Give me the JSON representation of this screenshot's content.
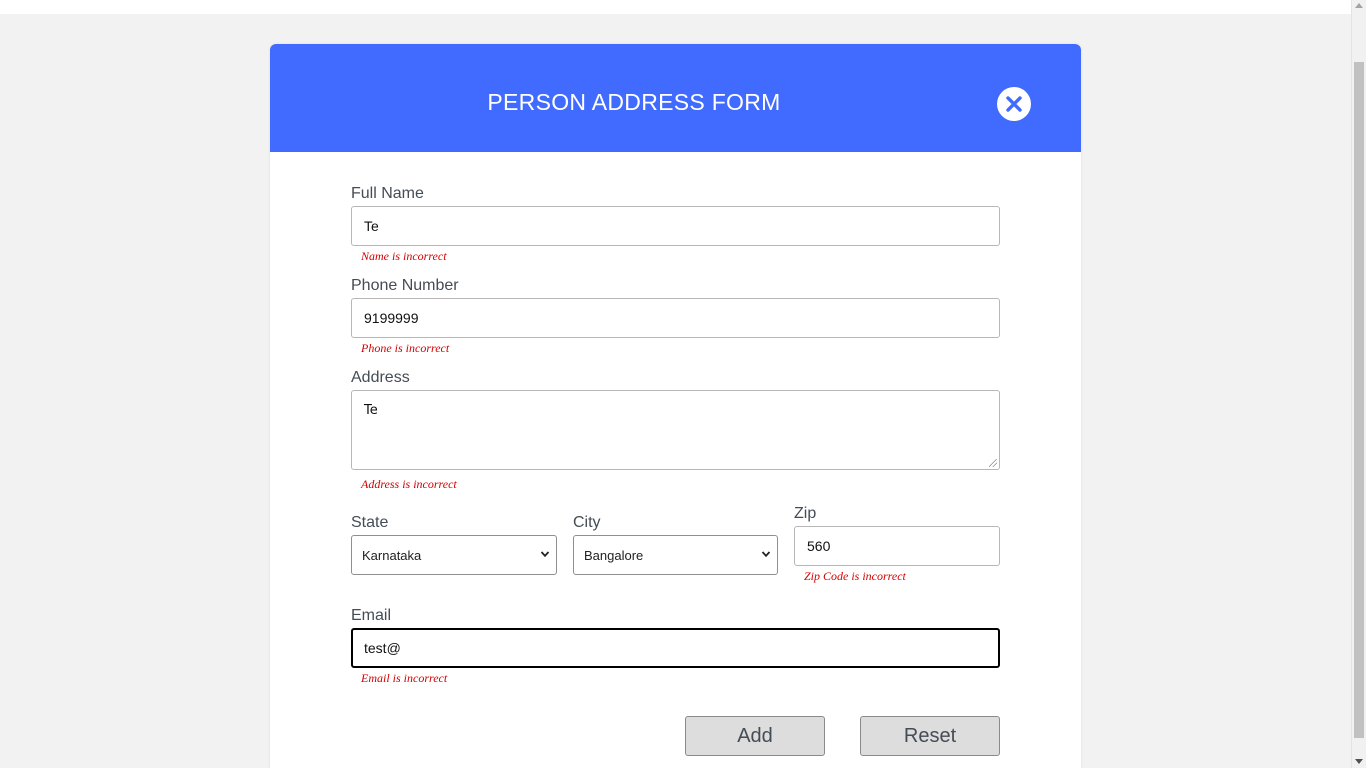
{
  "header": {
    "title": "PERSON ADDRESS FORM",
    "close_icon": "close-icon"
  },
  "fields": {
    "full_name": {
      "label": "Full Name",
      "value": "Te",
      "error": "Name is incorrect"
    },
    "phone": {
      "label": "Phone Number",
      "value": "9199999",
      "error": "Phone is incorrect"
    },
    "address": {
      "label": "Address",
      "value": "Te",
      "error": "Address is incorrect"
    },
    "state": {
      "label": "State",
      "value": "Karnataka"
    },
    "city": {
      "label": "City",
      "value": "Bangalore"
    },
    "zip": {
      "label": "Zip",
      "value": "560",
      "error": "Zip Code is incorrect"
    },
    "email": {
      "label": "Email",
      "value": "test@",
      "error": "Email is incorrect"
    }
  },
  "actions": {
    "add_label": "Add",
    "reset_label": "Reset"
  },
  "colors": {
    "header": "#416bff",
    "error": "#d40000",
    "page_bg": "#f2f2f2"
  }
}
